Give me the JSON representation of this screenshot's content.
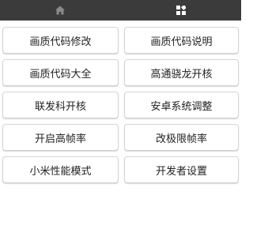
{
  "tabs": [
    {
      "icon": "home-icon"
    },
    {
      "icon": "grid-icon"
    }
  ],
  "buttons": [
    "画质代码修改",
    "画质代码说明",
    "画质代码大全",
    "高通骁龙开核",
    "联发科开核",
    "安卓系统调整",
    "开启高帧率",
    "改极限帧率",
    "小米性能模式",
    "开发者设置"
  ],
  "colors": {
    "tabbar_bg": "#3b3b3b",
    "tab_icon_inactive": "#8a8a8a",
    "tab_icon_active": "#ffffff",
    "button_border": "#d5d5d5"
  }
}
